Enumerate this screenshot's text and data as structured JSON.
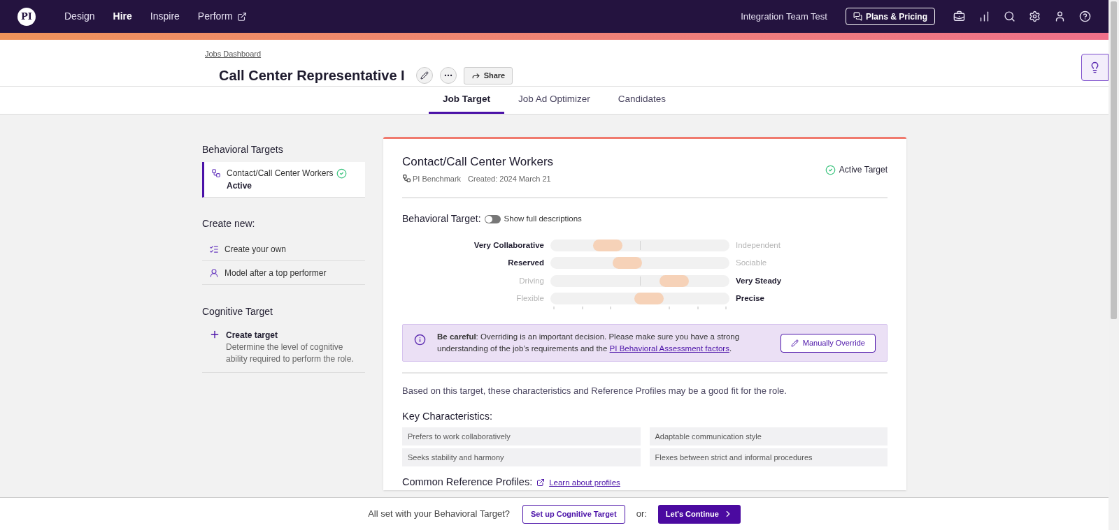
{
  "nav": {
    "logo": "PI",
    "items": [
      {
        "label": "Design",
        "selected": false,
        "external": false
      },
      {
        "label": "Hire",
        "selected": true,
        "external": false
      },
      {
        "label": "Inspire",
        "selected": false,
        "external": false
      },
      {
        "label": "Perform",
        "selected": false,
        "external": true
      }
    ],
    "account": "Integration Team Test",
    "plans_button": "Plans & Pricing"
  },
  "header": {
    "breadcrumb": "Jobs Dashboard",
    "title": "Call Center Representative I",
    "share_button": "Share"
  },
  "tabs": [
    {
      "label": "Job Target",
      "selected": true
    },
    {
      "label": "Job Ad Optimizer",
      "selected": false
    },
    {
      "label": "Candidates",
      "selected": false
    }
  ],
  "sidebar": {
    "behavioral_heading": "Behavioral Targets",
    "targets": [
      {
        "name": "Contact/Call Center Workers",
        "status": "Active",
        "selected": true,
        "verified": true
      }
    ],
    "create_heading": "Create new:",
    "create_items": [
      {
        "kind": "checklist",
        "label": "Create your own"
      },
      {
        "kind": "person",
        "label": "Model after a top performer"
      }
    ],
    "cognitive_heading": "Cognitive Target",
    "cognitive_item": {
      "title": "Create target",
      "description": "Determine the level of cognitive ability required to perform the role."
    }
  },
  "card": {
    "title": "Contact/Call Center Workers",
    "source": "PI Benchmark",
    "created": "Created: 2024 March 21",
    "status": "Active Target",
    "behavioral_label": "Behavioral Target:",
    "toggle": {
      "label": "Show full descriptions",
      "on": false
    },
    "scales": [
      {
        "left": "Very Collaborative",
        "right": "Independent",
        "left_strong": true,
        "right_strong": false,
        "level": 0.32
      },
      {
        "left": "Reserved",
        "right": "Sociable",
        "left_strong": true,
        "right_strong": false,
        "level": 0.43
      },
      {
        "left": "Driving",
        "right": "Very Steady",
        "left_strong": false,
        "right_strong": true,
        "level": 0.69
      },
      {
        "left": "Flexible",
        "right": "Precise",
        "left_strong": false,
        "right_strong": true,
        "level": 0.55
      }
    ],
    "notice": {
      "text": "**Be careful**: Overriding is an important decision. Please make sure you have a strong understanding of the job’s requirements and the ",
      "link": "PI Behavioral Assessment factors",
      "end": ".",
      "button": "Manually Override"
    },
    "intro": "Based on this target, these characteristics and Reference Profiles may be a good fit for the role.",
    "characteristics_heading": "Key Characteristics:",
    "characteristics": [
      "Prefers to work collaboratively",
      "Adaptable communication style",
      "Seeks stability and harmony",
      "Flexes between strict and informal procedures"
    ],
    "profiles_heading": "Common Reference Profiles:",
    "profiles_link": "Learn about profiles"
  },
  "footer": {
    "question": "All set with your Behavioral Target?",
    "secondary_button": "Set up Cognitive Target",
    "or": "or:",
    "primary_button": "Let's Continue"
  }
}
